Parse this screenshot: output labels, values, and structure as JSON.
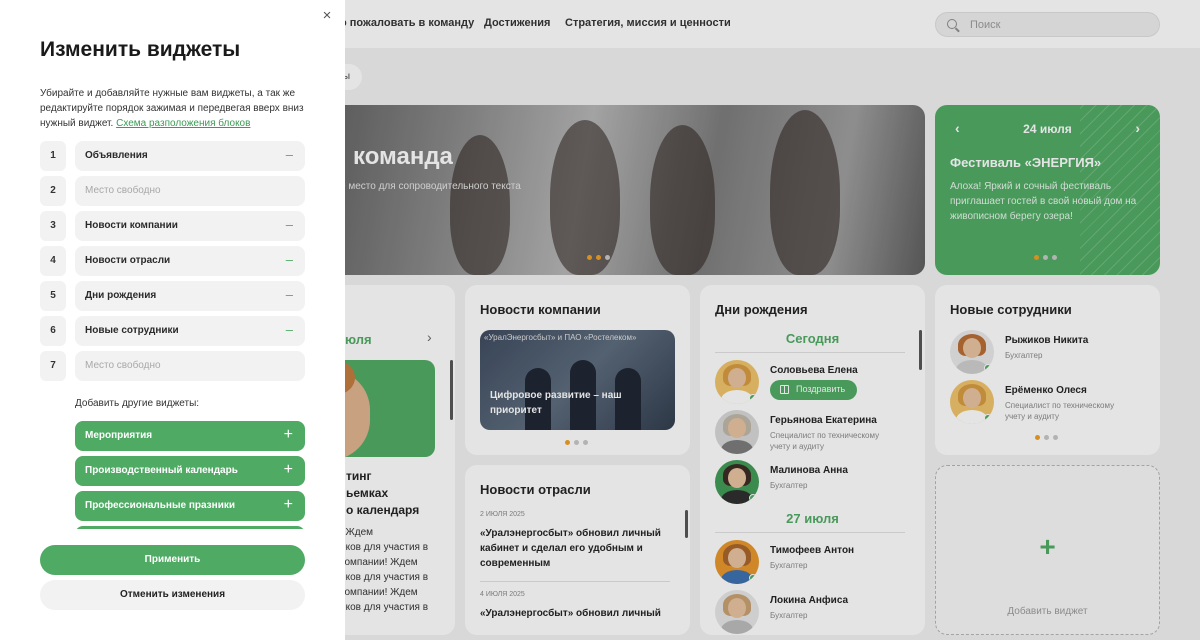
{
  "topnav": {
    "links": [
      "о пожаловать в команду",
      "Достижения",
      "Стратегия, миссия и ценности"
    ],
    "search_placeholder": "Поиск"
  },
  "chip": {
    "label": "ы"
  },
  "hero": {
    "title": "команда",
    "subtitle": "е место для сопроводительного текста"
  },
  "festival": {
    "date": "24 июля",
    "title": "Фестиваль «ЭНЕРГИЯ»",
    "text": "Алоха! Яркий и сочный фестиваль приглашает гостей в свой новый дом на живописном берегу озера!"
  },
  "events_card": {
    "month": "юля",
    "lines": [
      "тинг",
      "ьемках",
      "о календаря"
    ],
    "body": [
      "! Ждем",
      "иков для участия в",
      "компании! Ждем",
      "иков для участия в",
      "компании! Ждем",
      "иков для участия в"
    ]
  },
  "company_news": {
    "title": "Новости компании",
    "tag": "«УралЭнергосбыт» и ПАО «Ростелеком»",
    "caption": "Цифровое развитие – наш приоритет"
  },
  "industry_news": {
    "title": "Новости отрасли",
    "items": [
      {
        "date": "2 ИЮЛЯ 2025",
        "title": "«Уралэнергосбыт» обновил личный кабинет и сделал его удобным и современным"
      },
      {
        "date": "4 ИЮЛЯ 2025",
        "title": "«Уралэнергосбыт» обновил личный"
      }
    ]
  },
  "birthdays": {
    "title": "Дни рождения",
    "today_label": "Сегодня",
    "later_label": "27 июля",
    "congrats_label": "Поздравить",
    "people": [
      {
        "name": "Соловьева Елена",
        "role": ""
      },
      {
        "name": "Герьянова Екатерина",
        "role": "Специалист по техническому\nучету и аудиту"
      },
      {
        "name": "Малинова Анна",
        "role": "Бухгалтер"
      },
      {
        "name": "Тимофеев Антон",
        "role": "Бухгалтер"
      },
      {
        "name": "Локина Анфиса",
        "role": "Бухгалтер"
      }
    ]
  },
  "new_employees": {
    "title": "Новые сотрудники",
    "people": [
      {
        "name": "Рыжиков Никита",
        "role": "Бухгалтер"
      },
      {
        "name": "Ерёменко  Олеся",
        "role": "Специалист по техническому\nучету и аудиту"
      }
    ]
  },
  "add_widget_card": {
    "plus": "+",
    "label": "Добавить виджет"
  },
  "panel": {
    "close": "×",
    "title": "Изменить виджеты",
    "description": "Убирайте и добавляйте нужные вам виджеты, а так же редактируйте порядок зажимая и передвегая вверх вниз нужный виджет.",
    "scheme_link": "Схема разположения блоков",
    "slots": [
      {
        "num": "1",
        "label": "Объявления",
        "empty": false
      },
      {
        "num": "2",
        "label": "Место свободно",
        "empty": true
      },
      {
        "num": "3",
        "label": "Новости компании",
        "empty": false
      },
      {
        "num": "4",
        "label": "Новости отрасли",
        "empty": false
      },
      {
        "num": "5",
        "label": "Дни рождения",
        "empty": false
      },
      {
        "num": "6",
        "label": "Новые сотрудники",
        "empty": false
      },
      {
        "num": "7",
        "label": "Место свободно",
        "empty": true
      }
    ],
    "remove_symbol": "–",
    "add_other_label": "Добавить другие виджеты:",
    "available": [
      {
        "label": "Мероприятия"
      },
      {
        "label": "Производственный календарь"
      },
      {
        "label": "Профессиональные празники"
      },
      {
        "label": ""
      }
    ],
    "add_symbol": "+",
    "apply_label": "Применить",
    "cancel_label": "Отменить изменения"
  },
  "colors": {
    "accent": "#4faa64",
    "panel_bg": "#ffffff",
    "slot_bg": "#f2f2f2"
  }
}
